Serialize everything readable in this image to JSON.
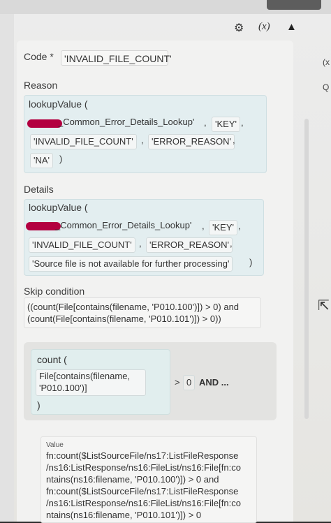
{
  "toolbar": {
    "gear_icon": "⚙",
    "fx_label": "(x)",
    "warning_icon": "▲",
    "right_x": "(x",
    "right_search": "Q"
  },
  "code": {
    "label": "Code *",
    "value": "'INVALID_FILE_COUNT'"
  },
  "reason": {
    "label": "Reason",
    "func": "lookupValue  (",
    "table_name": "_Common_Error_Details_Lookup'",
    "comma1": ",",
    "key": "'KEY'",
    "comma2": ",",
    "arg1": "'INVALID_FILE_COUNT'",
    "comma3": ",",
    "arg2": "'ERROR_REASON'",
    "comma4": ",",
    "arg3": "'NA'",
    "close": ")"
  },
  "details": {
    "label": "Details",
    "func": "lookupValue  (",
    "table_name": "_Common_Error_Details_Lookup'",
    "comma1": ",",
    "key": "'KEY'",
    "comma2": ",",
    "arg1": "'INVALID_FILE_COUNT'",
    "comma3": ",",
    "arg2": "'ERROR_REASON'",
    "comma4": ",",
    "arg3": "'Source file is not available for further processing'",
    "close": ")"
  },
  "skip": {
    "label": "Skip condition",
    "line1": "((count(File[contains(filename, 'P010.100')]) > 0) and",
    "line2": "(count(File[contains(filename, 'P010.101')]) > 0))"
  },
  "count_block": {
    "func": "count  (",
    "arg_line1": "File[contains(filename,",
    "arg_line2": "'P010.100')]",
    "close": ")",
    "operator": ">",
    "value": "0",
    "and_label": "AND ..."
  },
  "value_block": {
    "label": "Value",
    "lines": [
      "fn:count($ListSourceFile/ns17:ListFileResponse",
      "/ns16:ListResponse/ns16:FileList/ns16:File[fn:co",
      "ntains(ns16:filename, 'P010.100')]) > 0 and",
      "fn:count($ListSourceFile/ns17:ListFileResponse",
      "/ns16:ListResponse/ns16:FileList/ns16:File[fn:co",
      "ntains(ns16:filename, 'P010.101')]) > 0"
    ]
  }
}
